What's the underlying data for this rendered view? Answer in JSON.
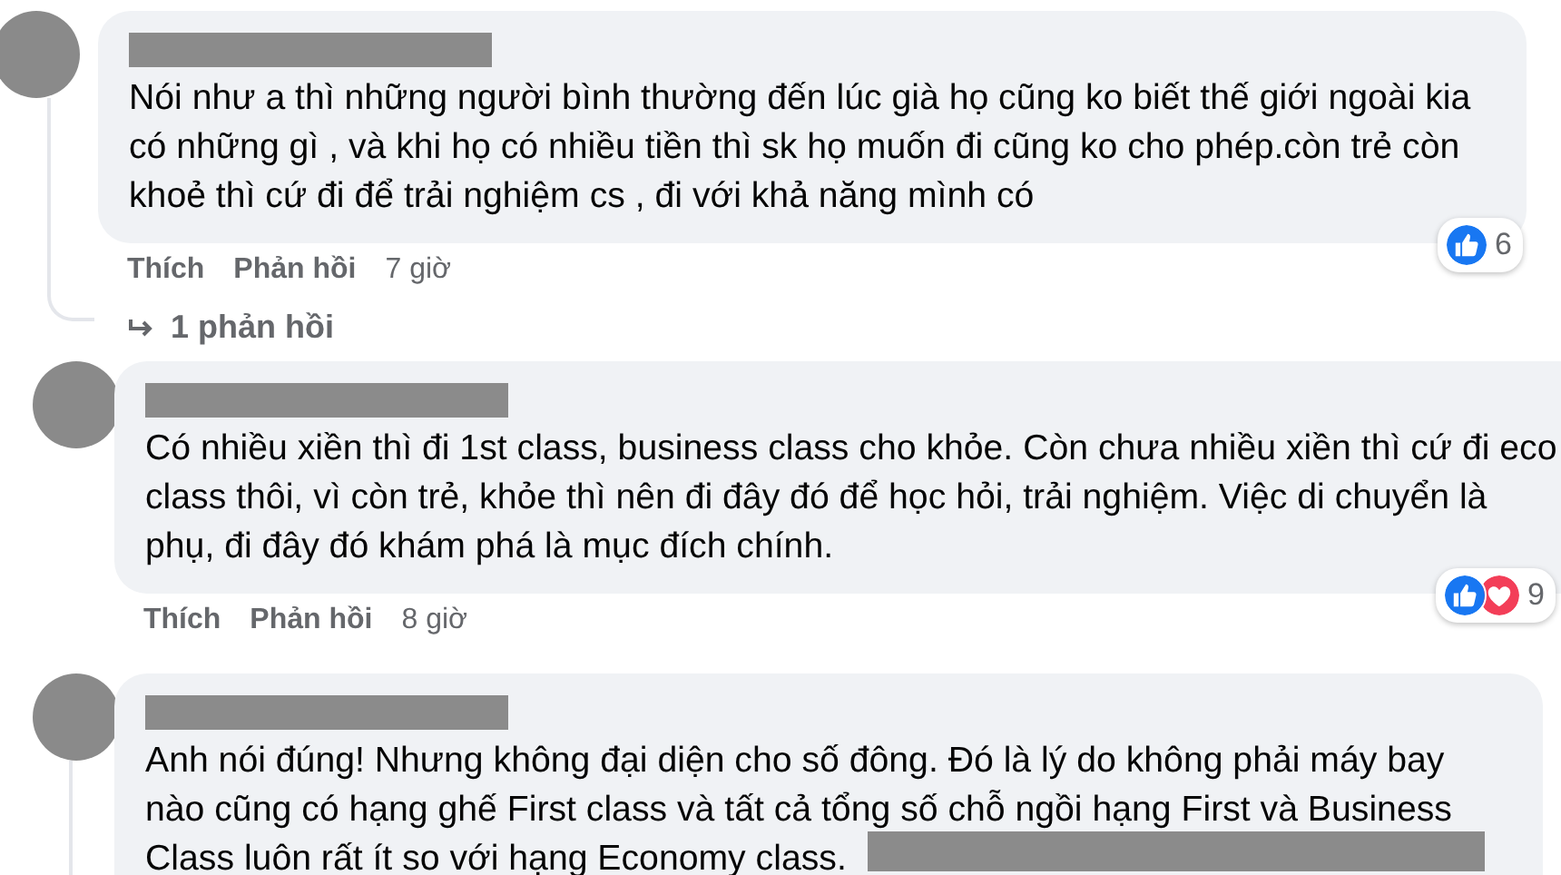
{
  "comments": [
    {
      "text": "Nói như a thì những người bình thường đến lúc già họ cũng ko biết thế giới ngoài kia có những gì , và khi họ có nhiều tiền thì sk họ muốn đi cũng ko cho phép.còn trẻ còn khoẻ thì cứ đi để trải nghiệm cs , đi với khả năng mình có",
      "redacted_tail": false,
      "actions": {
        "like": "Thích",
        "reply": "Phản hồi",
        "time": "7 giờ"
      },
      "reactions": {
        "icons": [
          {
            "kind": "like"
          }
        ],
        "count": "6"
      },
      "replies_link": "1 phản hồi",
      "thread_line": true
    },
    {
      "text": "Có nhiều xiền thì đi 1st class, business class cho khỏe. Còn chưa nhiều xiền thì cứ đi eco class thôi, vì còn trẻ, khỏe thì nên đi đây đó để học hỏi, trải nghiệm. Việc di chuyển là phụ, đi đây đó khám phá là mục đích chính.",
      "redacted_tail": false,
      "actions": {
        "like": "Thích",
        "reply": "Phản hồi",
        "time": "8 giờ"
      },
      "reactions": {
        "icons": [
          {
            "kind": "like"
          },
          {
            "kind": "love"
          }
        ],
        "count": "9"
      },
      "thread_line": false
    },
    {
      "text": "Anh nói đúng! Nhưng không đại diện cho số đông. Đó là lý do không phải máy bay nào cũng có hạng ghế First class và tất cả tổng số chỗ ngồi hạng First và Business Class luôn rất ít so với hạng Economy class.",
      "redacted_tail": true,
      "thread_line": true
    }
  ]
}
